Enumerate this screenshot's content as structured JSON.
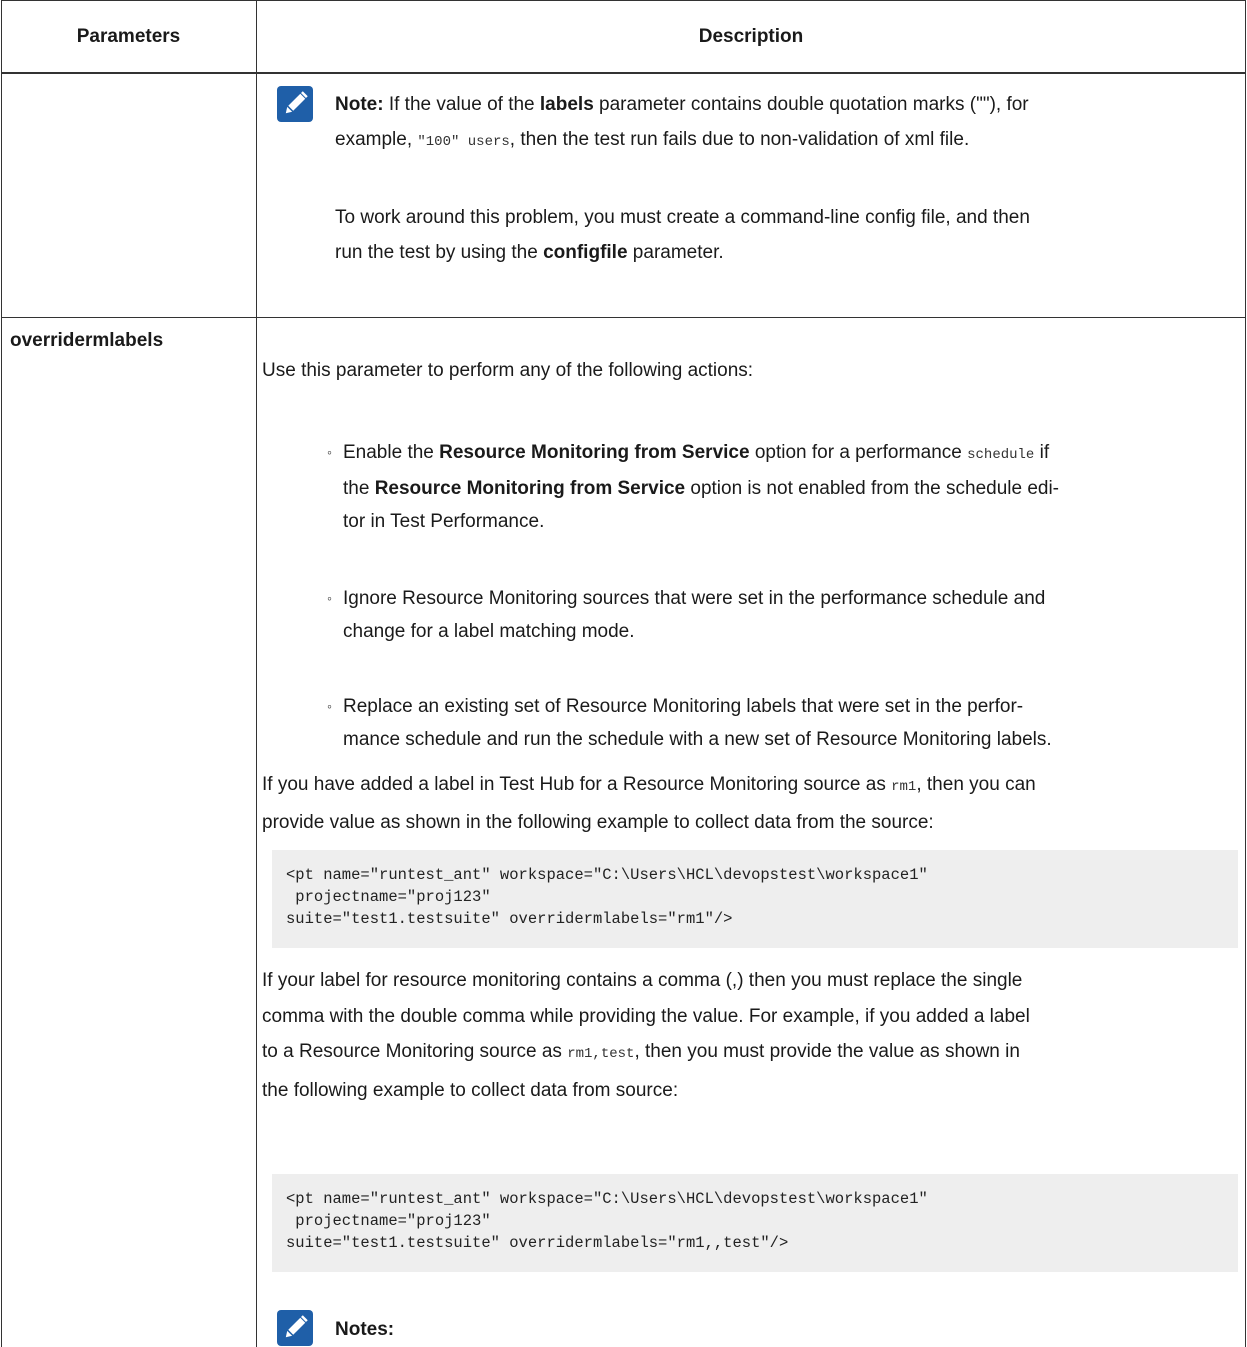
{
  "header": {
    "col1": "Parameters",
    "col2": "Description"
  },
  "row1": {
    "note_label": "Note:",
    "note_t1": " If the value of the ",
    "note_b1": "labels",
    "note_t2": " parameter contains double quotation marks (\"\"), for",
    "note_t3": "example, ",
    "note_code1": "\"100\" users",
    "note_t4": ", then the test run fails due to non-validation of xml file.",
    "work_t1": "To work around this problem, you must create a command-line config file, and then",
    "work_t2": "run the test by using the ",
    "work_b1": "configfile",
    "work_t3": " parameter."
  },
  "row2": {
    "param_name": "overridermlabels",
    "intro": "Use this parameter to perform any of the following actions:",
    "b1_t1": "Enable the ",
    "b1_b1": "Resource Monitoring from Service",
    "b1_t2": " option for a performance ",
    "b1_code": "schedule",
    "b1_t3": " if",
    "b1_l2_t1": "the ",
    "b1_l2_b1": "Resource Monitoring from Service",
    "b1_l2_t2": " option is not enabled from the schedule edi-",
    "b1_l3": "tor in Test Performance.",
    "b2_l1": "Ignore Resource Monitoring sources that were set in the performance schedule and",
    "b2_l2": "change for a label matching mode.",
    "b3_l1": "Replace an existing set of Resource Monitoring labels that were set in the perfor-",
    "b3_l2": "mance schedule and run the schedule with a new set of Resource Monitoring labels.",
    "p1_t1": "If you have added a label in Test Hub for a Resource Monitoring source as ",
    "p1_code": "rm1",
    "p1_t2": ", then you can",
    "p1_l2": "provide value as shown in the following example to collect data from the source:",
    "code1": "<pt name=\"runtest_ant\" workspace=\"C:\\Users\\HCL\\devopstest\\workspace1\"\n projectname=\"proj123\"\nsuite=\"test1.testsuite\" overridermlabels=\"rm1\"/>",
    "p2_l1": "If your label for resource monitoring contains a comma (,) then you must replace the single",
    "p2_l2": "comma with the double comma while providing the value. For example, if you added a label",
    "p2_l3_t1": "to a Resource Monitoring source as ",
    "p2_l3_code": "rm1,test",
    "p2_l3_t2": ", then you must provide the value as shown in",
    "p2_l4": "the following example to collect data from source:",
    "code2": "<pt name=\"runtest_ant\" workspace=\"C:\\Users\\HCL\\devopstest\\workspace1\"\n projectname=\"proj123\"\nsuite=\"test1.testsuite\" overridermlabels=\"rm1,,test\"/>",
    "notes_label": "Notes:"
  },
  "icons": {
    "note_icon": "pencil-note-icon",
    "color": "#1f5fa8"
  }
}
